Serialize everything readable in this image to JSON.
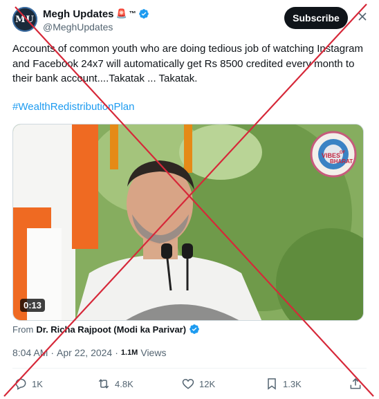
{
  "author": {
    "avatar_text": "MU",
    "name": "Megh Updates",
    "siren_glyph": "🚨",
    "trademark": "™",
    "handle": "@MeghUpdates",
    "verified_icon": "verified-badge-icon"
  },
  "header": {
    "subscribe_label": "Subscribe",
    "more_icon": "close-x-icon"
  },
  "tweet": {
    "text": "Accounts of common youth who are doing tedious job of watching Instagram and Facebook 24x7 will automatically get Rs 8500 credited every month to their bank account....Takatak ... Takatak.",
    "hashtag": "#WealthRedistributionPlan"
  },
  "media": {
    "duration": "0:13",
    "watermark_text_1": "VIBES",
    "watermark_text_2": "OF",
    "watermark_text_3": "BHARAT"
  },
  "source": {
    "from_label": "From",
    "from_name": "Dr. Richa Rajpoot (Modi ka Parivar)"
  },
  "meta": {
    "time": "8:04 AM",
    "separator": "·",
    "date": "Apr 22, 2024",
    "views_count": "1.1M",
    "views_label": "Views"
  },
  "actions": {
    "replies": "1K",
    "reposts": "4.8K",
    "likes": "12K",
    "bookmarks": "1.3K"
  },
  "colors": {
    "accent": "#1d9bf0",
    "cross": "#d62839",
    "text": "#0f1419",
    "muted": "#536471"
  }
}
